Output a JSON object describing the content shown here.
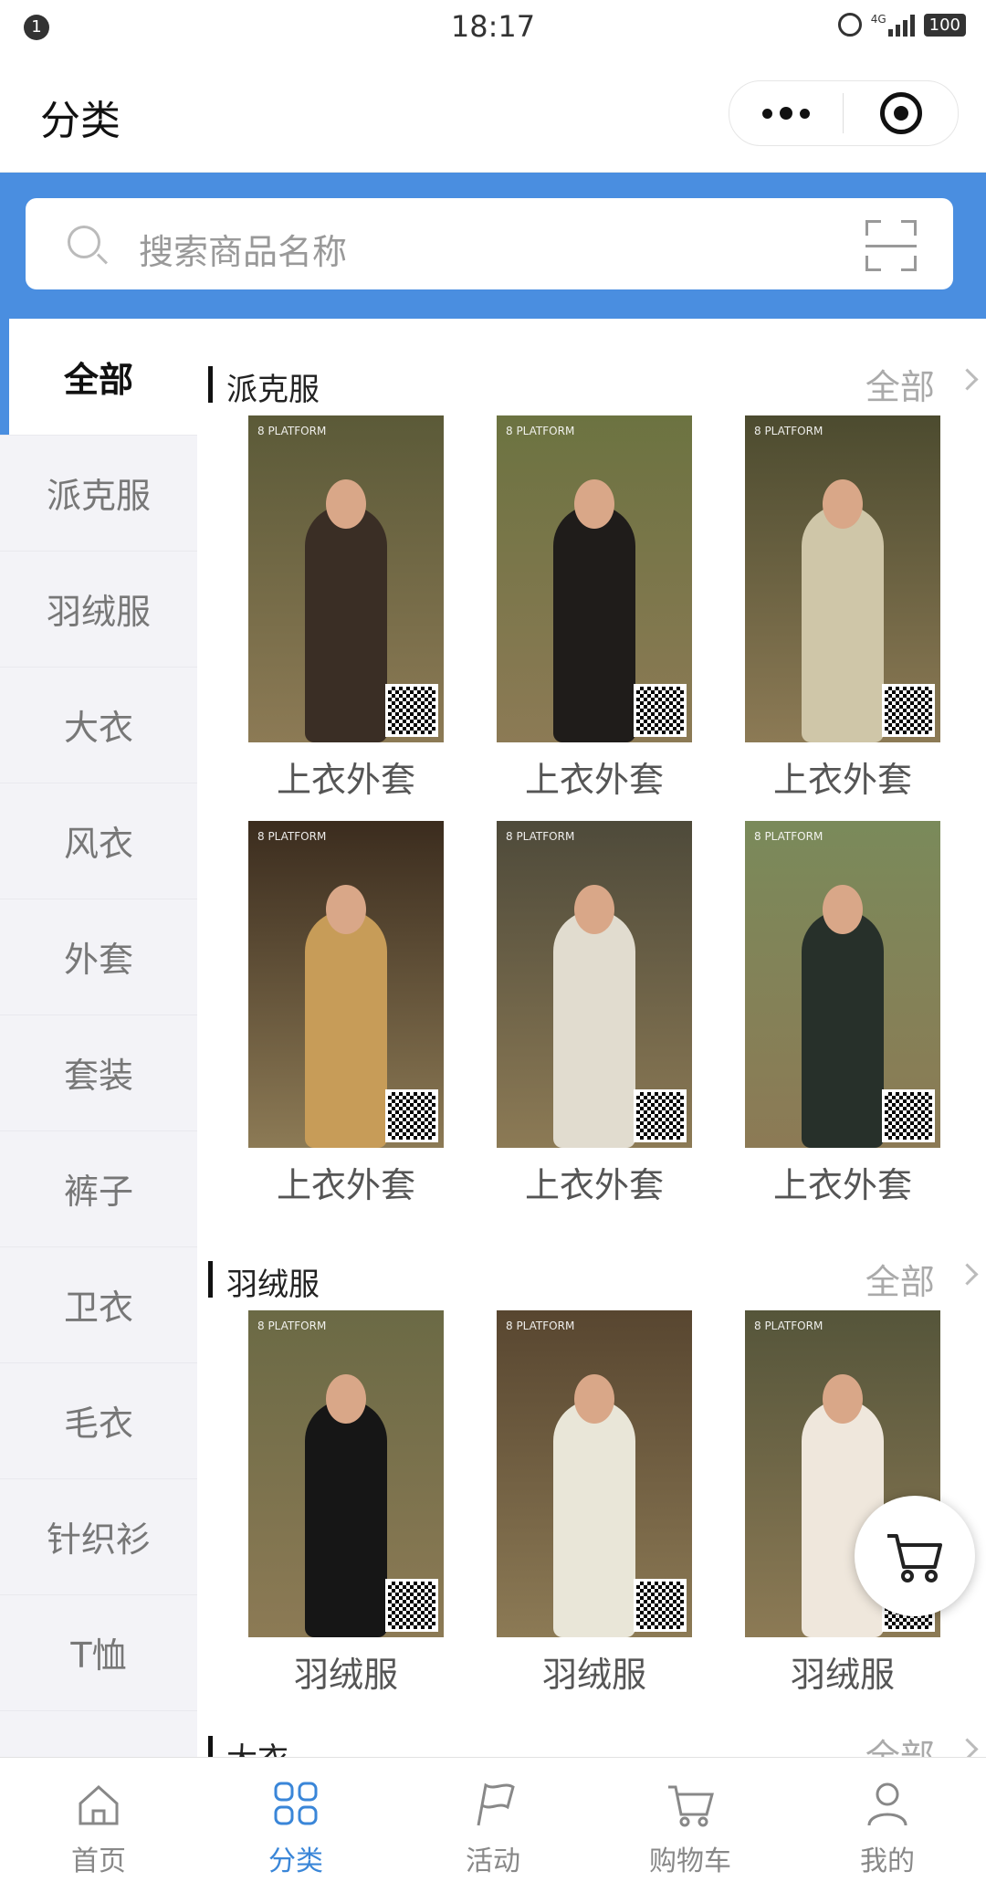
{
  "status_bar": {
    "notification_count": "1",
    "time": "18:17",
    "network": "4G",
    "battery": "100"
  },
  "header": {
    "title": "分类"
  },
  "search": {
    "placeholder": "搜索商品名称"
  },
  "sidebar": {
    "items": [
      {
        "label": "全部",
        "active": true
      },
      {
        "label": "派克服"
      },
      {
        "label": "羽绒服"
      },
      {
        "label": "大衣"
      },
      {
        "label": "风衣"
      },
      {
        "label": "外套"
      },
      {
        "label": "套装"
      },
      {
        "label": "裤子"
      },
      {
        "label": "卫衣"
      },
      {
        "label": "毛衣"
      },
      {
        "label": "针织衫"
      },
      {
        "label": "T恤"
      }
    ]
  },
  "sections": [
    {
      "name": "派克服",
      "all_label": "全部",
      "products": [
        {
          "label": "上衣外套",
          "coat": "#3a2e25",
          "bg": "#5b5a38"
        },
        {
          "label": "上衣外套",
          "coat": "#1f1c1a",
          "bg": "#6c7341"
        },
        {
          "label": "上衣外套",
          "coat": "#cfc6a8",
          "bg": "#4c4b2f"
        },
        {
          "label": "上衣外套",
          "coat": "#c79c58",
          "bg": "#3b2c1e"
        },
        {
          "label": "上衣外套",
          "coat": "#e1dccf",
          "bg": "#4e4a3a"
        },
        {
          "label": "上衣外套",
          "coat": "#27302a",
          "bg": "#7a8a5a"
        }
      ]
    },
    {
      "name": "羽绒服",
      "all_label": "全部",
      "products": [
        {
          "label": "羽绒服",
          "coat": "#161616",
          "bg": "#6b6a45"
        },
        {
          "label": "羽绒服",
          "coat": "#e9e6d8",
          "bg": "#584630"
        },
        {
          "label": "羽绒服",
          "coat": "#efe7dc",
          "bg": "#55553a"
        }
      ]
    },
    {
      "name": "大衣",
      "all_label": "全部"
    }
  ],
  "product_brand": "8 PLATFORM",
  "tabbar": {
    "items": [
      {
        "label": "首页",
        "icon": "home-icon"
      },
      {
        "label": "分类",
        "icon": "category-grid-icon",
        "active": true
      },
      {
        "label": "活动",
        "icon": "flag-icon"
      },
      {
        "label": "购物车",
        "icon": "cart-icon"
      },
      {
        "label": "我的",
        "icon": "profile-icon"
      }
    ]
  },
  "colors": {
    "accent": "#4a8ee0",
    "tab_active": "#3a86d8",
    "sidebar_bg": "#f3f3f7"
  }
}
